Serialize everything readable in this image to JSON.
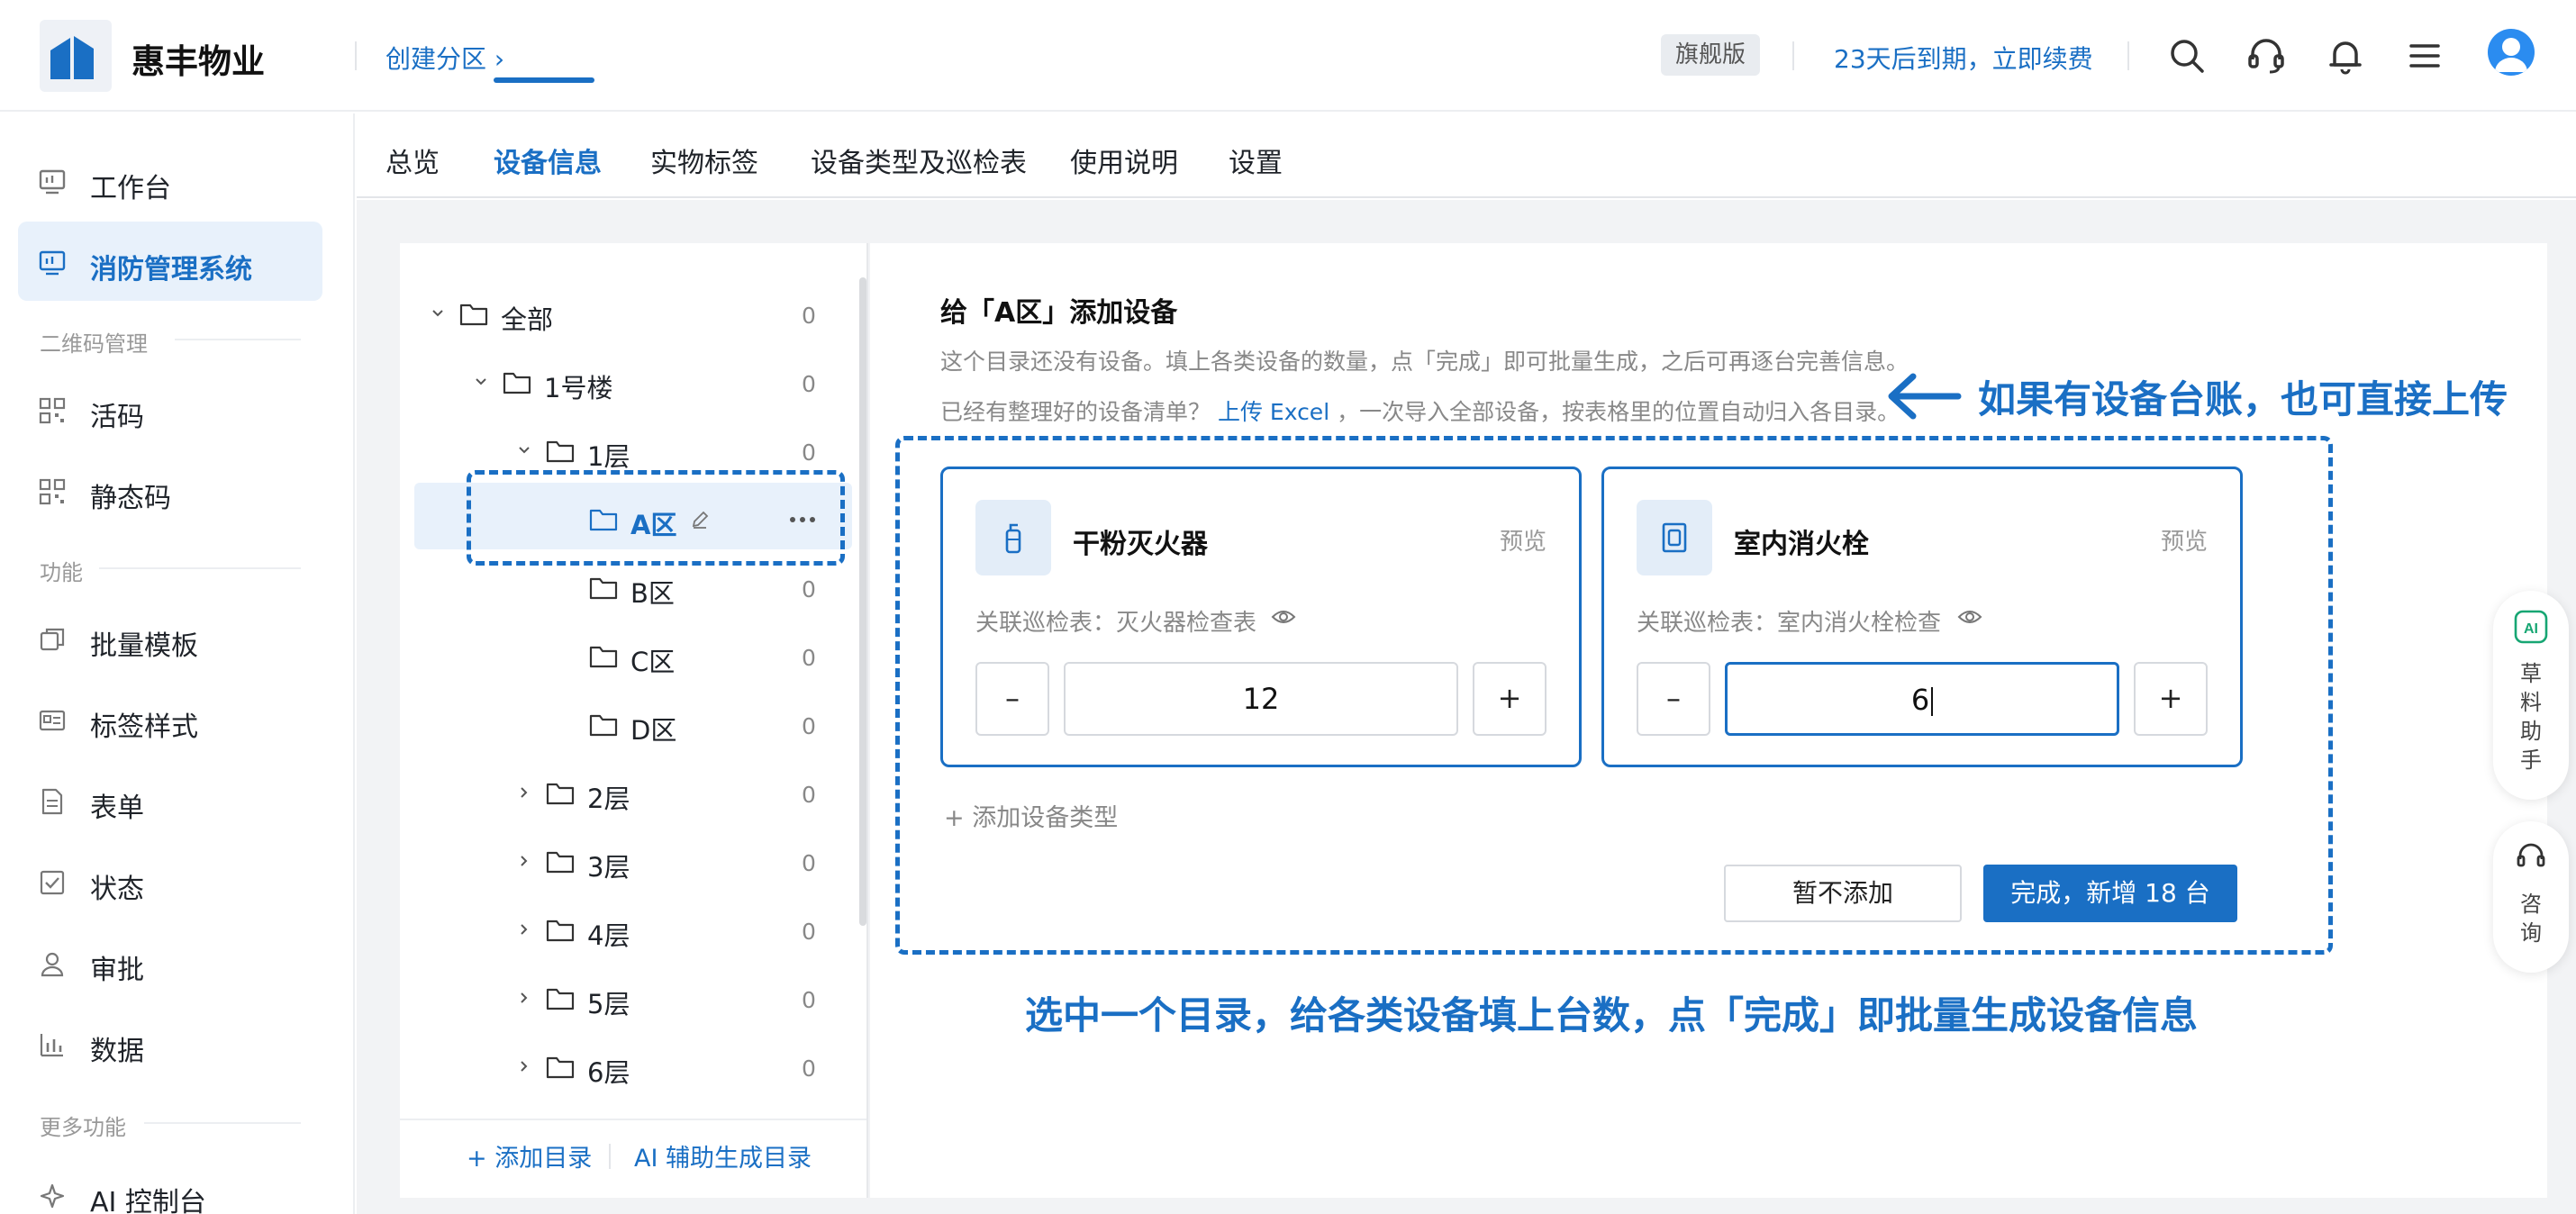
{
  "header": {
    "brand": "惠丰物业",
    "breadcrumb": "创建分区 ›",
    "edition_badge": "旗舰版",
    "expire_text": "23天后到期，立即续费",
    "icons": [
      "search-icon",
      "headset-icon",
      "bell-icon",
      "menu-icon",
      "avatar"
    ]
  },
  "sidebar": {
    "items": [
      {
        "label": "工作台",
        "icon": "monitor-icon"
      },
      {
        "label": "消防管理系统",
        "icon": "monitor-icon",
        "active": true
      }
    ],
    "group_qr": "二维码管理",
    "qr_items": [
      {
        "label": "活码",
        "icon": "qrcode-icon"
      },
      {
        "label": "静态码",
        "icon": "qrcode-icon"
      }
    ],
    "group_func": "功能",
    "func_items": [
      {
        "label": "批量模板",
        "icon": "copy-icon"
      },
      {
        "label": "标签样式",
        "icon": "card-icon"
      },
      {
        "label": "表单",
        "icon": "document-icon"
      },
      {
        "label": "状态",
        "icon": "checkbox-icon"
      },
      {
        "label": "审批",
        "icon": "user-icon"
      },
      {
        "label": "数据",
        "icon": "bar-chart-icon"
      }
    ],
    "group_more": "更多功能",
    "more_items": [
      {
        "label": "AI 控制台",
        "icon": "sparkle-icon"
      }
    ]
  },
  "tabs": [
    "总览",
    "设备信息",
    "实物标签",
    "设备类型及巡检表",
    "使用说明",
    "设置"
  ],
  "active_tab": "设备信息",
  "tree": {
    "rows": [
      {
        "name": "全部",
        "count": "0",
        "expanded": true
      },
      {
        "name": "1号楼",
        "count": "0",
        "expanded": true
      },
      {
        "name": "1层",
        "count": "0",
        "expanded": true
      },
      {
        "name": "A区",
        "selected": true
      },
      {
        "name": "B区",
        "count": "0"
      },
      {
        "name": "C区",
        "count": "0"
      },
      {
        "name": "D区",
        "count": "0"
      },
      {
        "name": "2层",
        "count": "0",
        "expanded": false
      },
      {
        "name": "3层",
        "count": "0",
        "expanded": false
      },
      {
        "name": "4层",
        "count": "0",
        "expanded": false
      },
      {
        "name": "5层",
        "count": "0",
        "expanded": false
      },
      {
        "name": "6层",
        "count": "0",
        "expanded": false
      }
    ],
    "add_dir": "+ 添加目录",
    "ai_dir": "AI 辅助生成目录"
  },
  "content": {
    "title": "给「A区」添加设备",
    "desc": "这个目录还没有设备。填上各类设备的数量，点「完成」即可批量生成，之后可再逐台完善信息。",
    "desc2_prefix": "已经有整理好的设备清单？",
    "desc2_link": "上传 Excel",
    "desc2_suffix": "，一次导入全部设备，按表格里的位置自动归入各目录。",
    "cards": [
      {
        "name": "干粉灭火器",
        "preview": "预览",
        "link": "关联巡检表：灭火器检查表",
        "value": "12"
      },
      {
        "name": "室内消火栓",
        "preview": "预览",
        "link": "关联巡检表：室内消火栓检查",
        "value": "6"
      }
    ],
    "minus": "–",
    "plus": "+",
    "add_type": "+ 添加设备类型",
    "skip_button": "暂不添加",
    "done_button": "完成，新增 18 台"
  },
  "annotations": {
    "upload_hint": "如果有设备台账，也可直接上传",
    "bottom_hint": "选中一个目录，给各类设备填上台数，点「完成」即批量生成设备信息"
  },
  "float": {
    "ai_helper": [
      "草",
      "料",
      "助",
      "手"
    ],
    "consult": [
      "咨",
      "询"
    ]
  },
  "colors": {
    "accent": "#1a6fc4",
    "active_bg": "#e8f1fb",
    "page_bg": "#f2f3f5"
  }
}
